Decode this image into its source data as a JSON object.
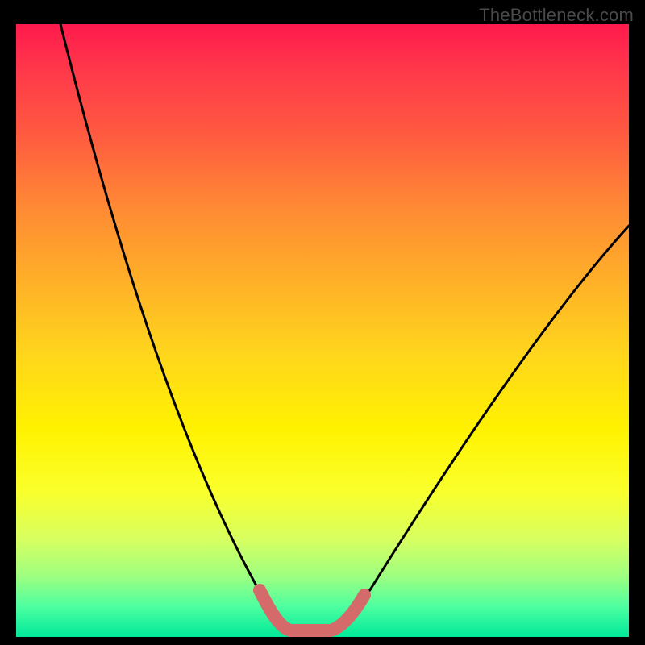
{
  "watermark": "TheBottleneck.com",
  "chart_data": {
    "type": "line",
    "title": "",
    "xlabel": "",
    "ylabel": "",
    "xlim": [
      0,
      100
    ],
    "ylim": [
      0,
      100
    ],
    "series": [
      {
        "name": "bottleneck-curve",
        "x": [
          0,
          5,
          10,
          15,
          20,
          25,
          30,
          35,
          38,
          41,
          44,
          47,
          50,
          55,
          60,
          65,
          70,
          75,
          80,
          85,
          90,
          95,
          100
        ],
        "y": [
          100,
          92,
          84,
          75,
          66,
          56,
          45,
          33,
          22,
          11,
          2,
          0,
          0,
          5,
          12,
          20,
          28,
          36,
          43,
          50,
          56,
          61,
          65
        ]
      },
      {
        "name": "optimal-band",
        "x": [
          41,
          44,
          47,
          50
        ],
        "y": [
          3,
          0,
          0,
          3
        ]
      }
    ],
    "colors": {
      "curve": "#000000",
      "band": "#d46a6a",
      "gradient_top": "#ff1a4d",
      "gradient_bottom": "#00e89a"
    }
  }
}
